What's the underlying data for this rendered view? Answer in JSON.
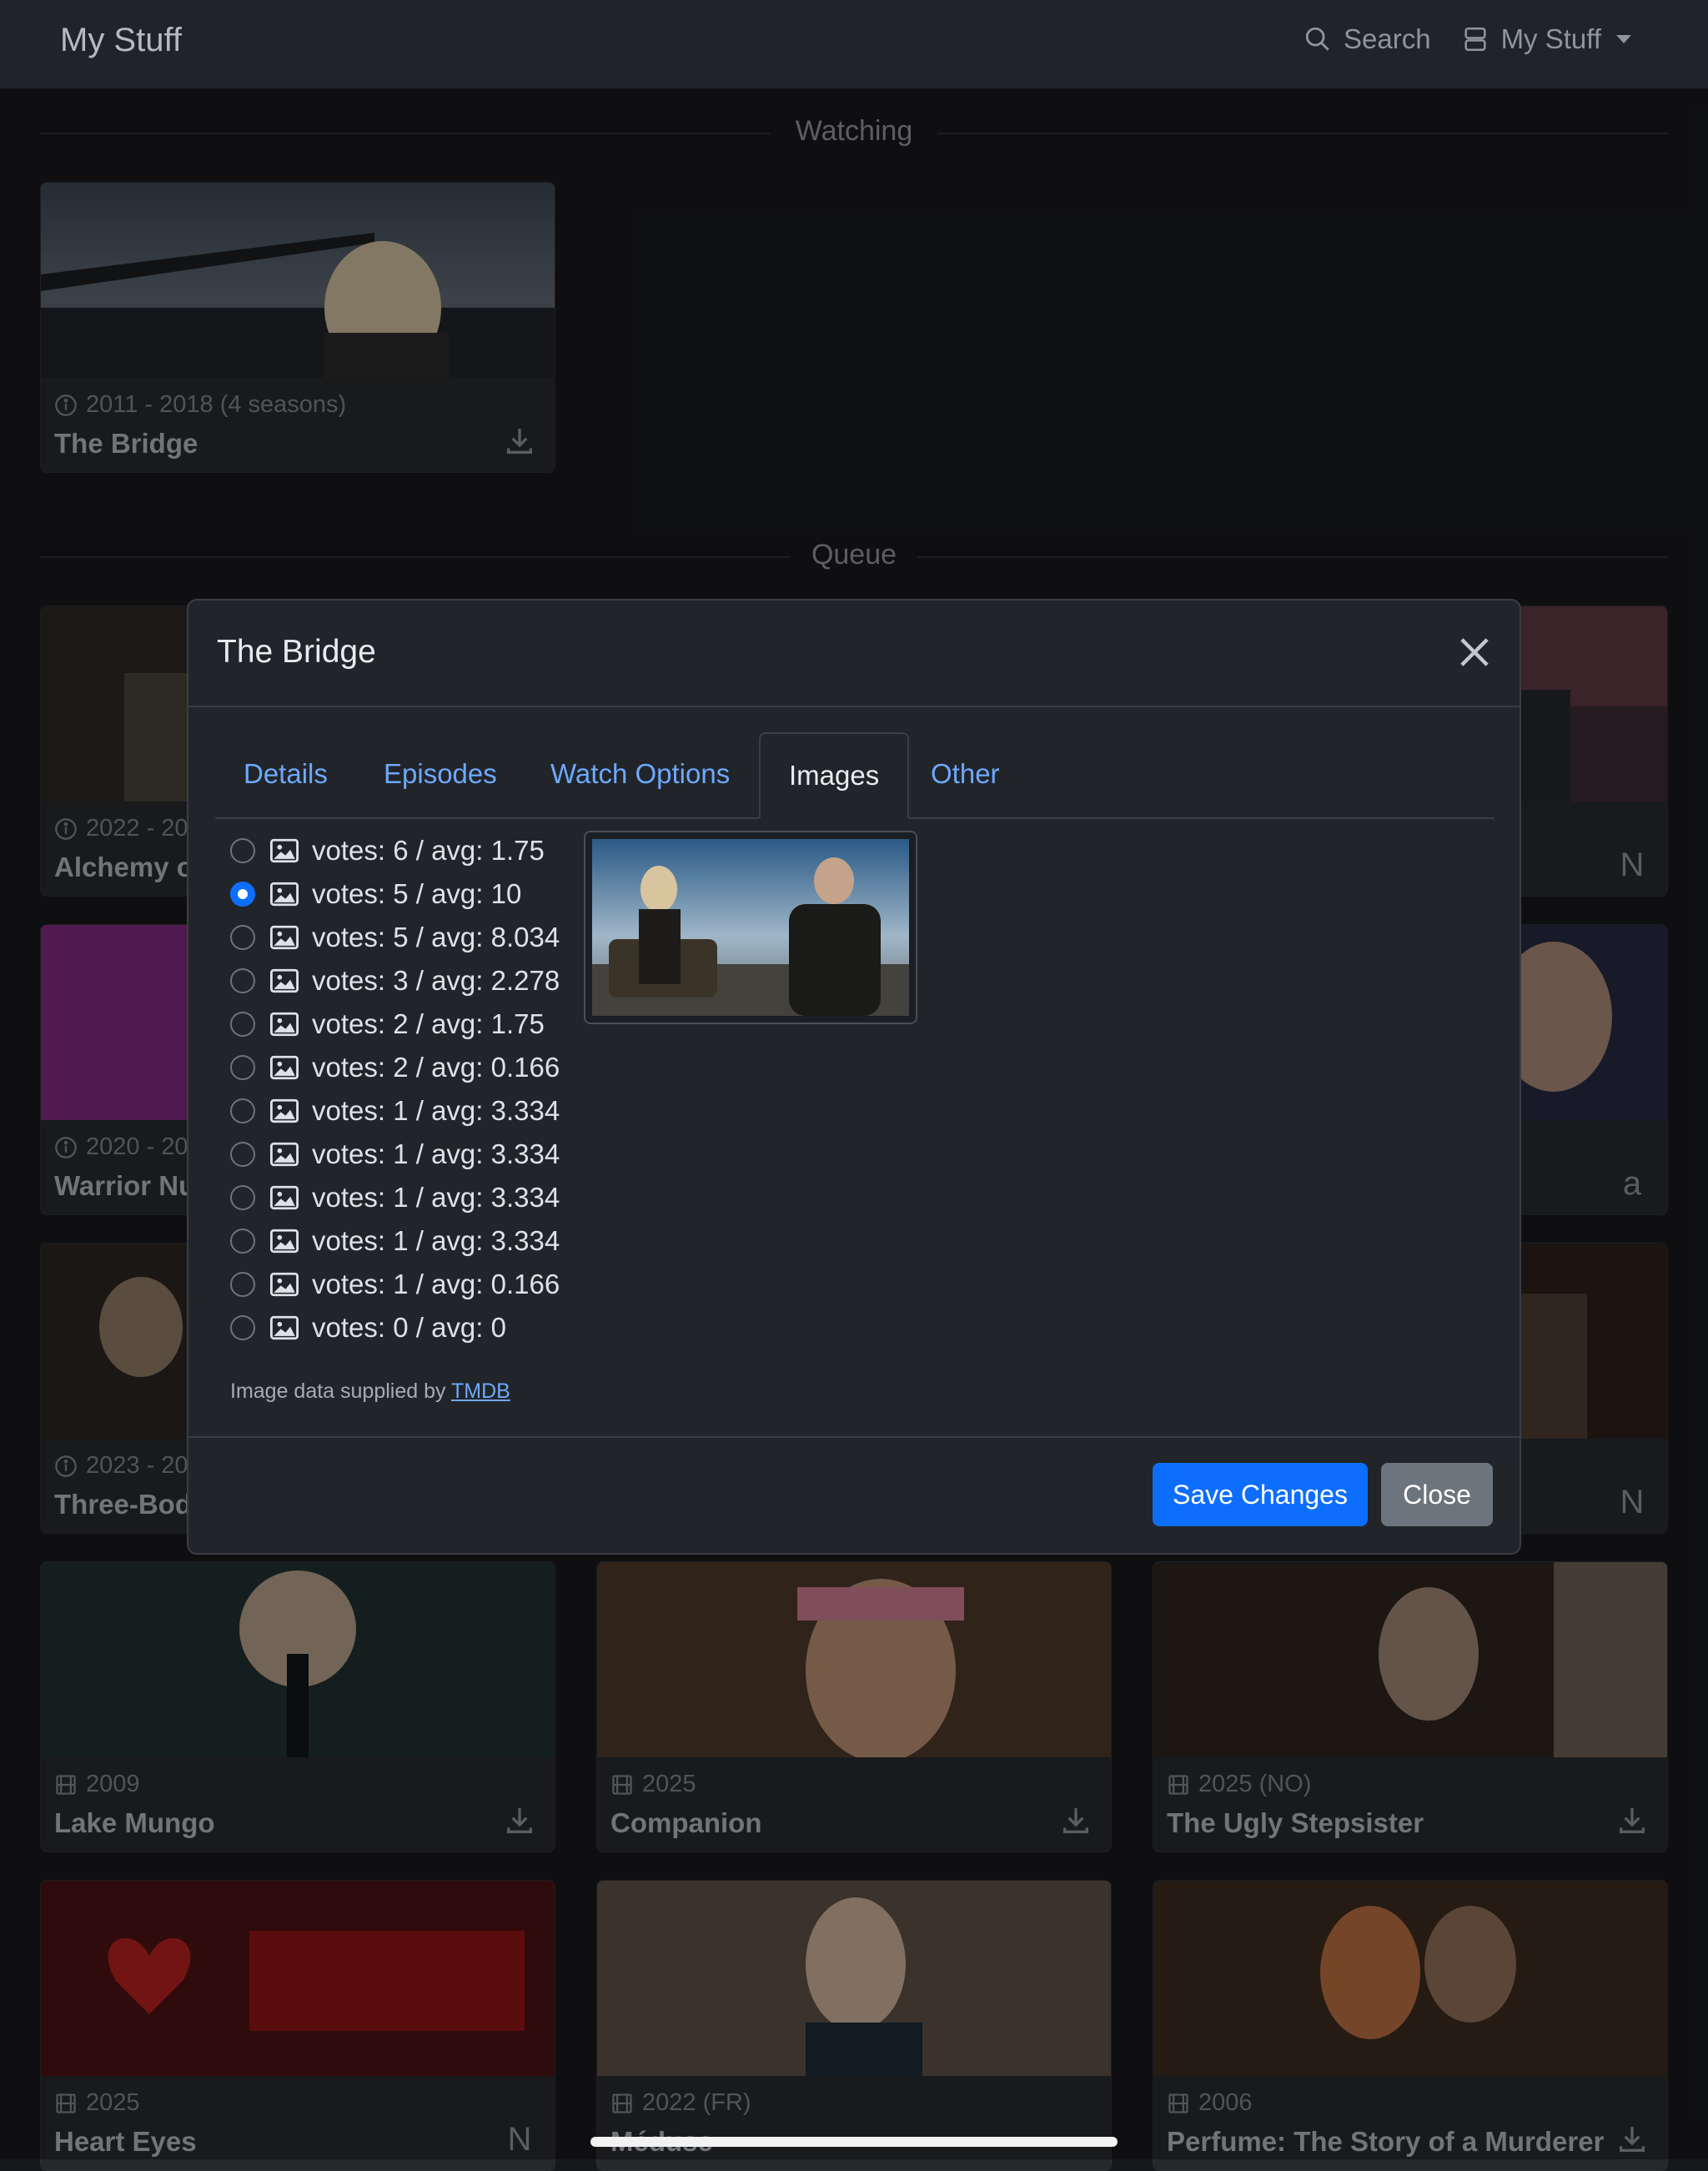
{
  "navbar": {
    "brand": "My Stuff",
    "search_label": "Search",
    "mystuff_label": "My Stuff"
  },
  "sections": {
    "watching": "Watching",
    "queue": "Queue"
  },
  "cards": {
    "bridge": {
      "meta": "2011 - 2018 (4 seasons)",
      "title": "The Bridge",
      "meta_icon": "info-icon",
      "action_icon": "download-icon"
    },
    "alchemy": {
      "meta": "2022 - 20",
      "title": "Alchemy o",
      "meta_icon": "info-icon"
    },
    "warrior": {
      "meta": "2020 - 20",
      "title": "Warrior Nu",
      "meta_icon": "info-icon"
    },
    "threebody": {
      "meta": "2023 - 20",
      "title": "Three-Bod",
      "meta_icon": "info-icon"
    },
    "right1": {
      "action": "N",
      "action_icon": "netflix-icon"
    },
    "right2": {
      "action": "a",
      "action_icon": "amazon-icon"
    },
    "right3": {
      "action": "N",
      "action_icon": "netflix-icon"
    },
    "lakemungo": {
      "meta": "2009",
      "title": "Lake Mungo",
      "meta_icon": "film-icon",
      "action_icon": "download-icon"
    },
    "companion": {
      "meta": "2025",
      "title": "Companion",
      "meta_icon": "film-icon",
      "action_icon": "download-icon"
    },
    "uglystep": {
      "meta": "2025 (NO)",
      "title": "The Ugly Stepsister",
      "meta_icon": "film-icon",
      "action_icon": "download-icon"
    },
    "hearteyes": {
      "meta": "2025",
      "title": "Heart Eyes",
      "meta_icon": "film-icon",
      "action": "N",
      "action_icon": "netflix-icon"
    },
    "meduse": {
      "meta": "2022 (FR)",
      "title": "Méduse",
      "meta_icon": "film-icon"
    },
    "perfume": {
      "meta": "2006",
      "title": "Perfume: The Story of a Murderer",
      "meta_icon": "film-icon",
      "action_icon": "download-icon"
    }
  },
  "modal": {
    "title": "The Bridge",
    "tabs": [
      "Details",
      "Episodes",
      "Watch Options",
      "Images",
      "Other"
    ],
    "active_tab": "Images",
    "options": [
      {
        "label": "votes: 6 / avg: 1.75",
        "checked": false
      },
      {
        "label": "votes: 5 / avg: 10",
        "checked": true
      },
      {
        "label": "votes: 5 / avg: 8.034",
        "checked": false
      },
      {
        "label": "votes: 3 / avg: 2.278",
        "checked": false
      },
      {
        "label": "votes: 2 / avg: 1.75",
        "checked": false
      },
      {
        "label": "votes: 2 / avg: 0.166",
        "checked": false
      },
      {
        "label": "votes: 1 / avg: 3.334",
        "checked": false
      },
      {
        "label": "votes: 1 / avg: 3.334",
        "checked": false
      },
      {
        "label": "votes: 1 / avg: 3.334",
        "checked": false
      },
      {
        "label": "votes: 1 / avg: 3.334",
        "checked": false
      },
      {
        "label": "votes: 1 / avg: 0.166",
        "checked": false
      },
      {
        "label": "votes: 0 / avg: 0",
        "checked": false
      }
    ],
    "credit_text": "Image data supplied by ",
    "credit_link": "TMDB",
    "save_label": "Save Changes",
    "close_label": "Close"
  },
  "colors": {
    "accent": "#0d6efd",
    "link": "#6ea8fe",
    "background": "#17181b"
  }
}
